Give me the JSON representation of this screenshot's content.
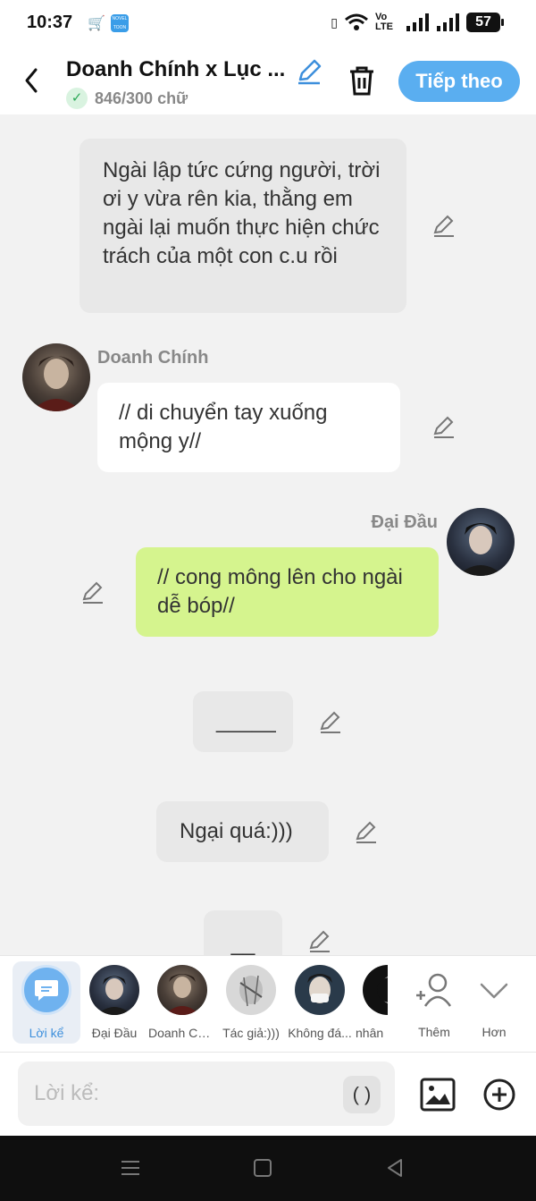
{
  "status": {
    "time": "10:37",
    "app2_label": "NOVEL TOON",
    "network": "Vo LTE",
    "battery": "57"
  },
  "header": {
    "title": "Doanh Chính x Lục ...",
    "word_count": "846/300 chữ",
    "next_label": "Tiếp theo"
  },
  "messages": [
    {
      "text": "Ngài lập tức cứng người, trời ơi y vừa rên kia, thằng em ngài lại muốn thực hiện chức trách của một con c.u rồi"
    },
    {
      "speaker": "Doanh Chính",
      "text": "// di chuyển tay xuống mộng y//"
    },
    {
      "speaker": "Đại Đầu",
      "text": "// cong mông lên cho ngài dễ bóp//"
    },
    {
      "text": "_____"
    },
    {
      "text": "Ngại quá:)))"
    },
    {
      "text": "__"
    }
  ],
  "characters": [
    {
      "label": "Lời kể"
    },
    {
      "label": "Đại Đầu"
    },
    {
      "label": "Doanh Chí..."
    },
    {
      "label": "Tác giả:)))"
    },
    {
      "label": "Không đá..."
    },
    {
      "label": "nhân"
    }
  ],
  "toolbar": {
    "more_label": "Thêm",
    "collapse_label": "Hơn"
  },
  "input": {
    "placeholder": "Lời kể:",
    "paren_label": "( )"
  },
  "colors": {
    "accent": "#5aaef0",
    "green_bubble": "#d5f48e",
    "gray_bubble": "#e8e8e8"
  }
}
